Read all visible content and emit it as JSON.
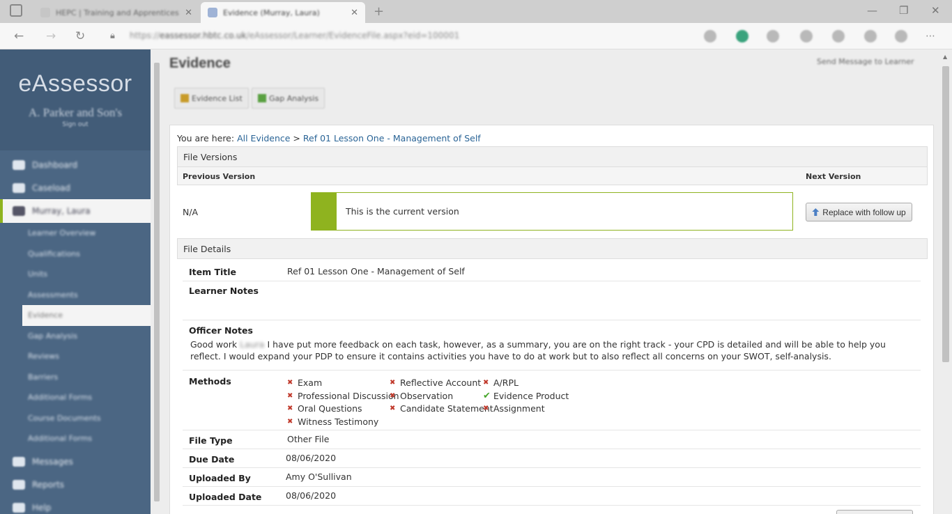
{
  "browser": {
    "tabs": [
      {
        "title": "HEPC | Training and Apprentices",
        "active": false
      },
      {
        "title": "Evidence (Murray, Laura)",
        "active": true
      }
    ],
    "url_prefix": "https://",
    "url_domain": "eassessor.hbtc.co.uk",
    "url_path": "/eAssessor/Learner/EvidenceFile.aspx?eid=100001"
  },
  "sidebar": {
    "brand": "eAssessor",
    "org": "A. Parker and Son's",
    "signout": "Sign out",
    "nav": [
      {
        "label": "Dashboard",
        "icon": "dashboard-icon"
      },
      {
        "label": "Caseload",
        "icon": "caseload-icon"
      },
      {
        "label": "Murray, Laura",
        "icon": "learner-icon"
      }
    ],
    "subnav": [
      "Learner Overview",
      "Qualifications",
      "Units",
      "Assessments",
      "Evidence",
      "Gap Analysis",
      "Reviews",
      "Barriers",
      "Additional Forms",
      "Course Documents",
      "Additional Forms"
    ],
    "nav_bottom": [
      {
        "label": "Messages",
        "icon": "messages-icon"
      },
      {
        "label": "Reports",
        "icon": "reports-icon"
      },
      {
        "label": "Help",
        "icon": "help-icon"
      }
    ]
  },
  "main": {
    "title": "Evidence",
    "send_message": "Send Message to Learner",
    "evidence_list_btn": "Evidence List",
    "gap_analysis_btn": "Gap Analysis",
    "breadcrumb": {
      "prefix": "You are here:",
      "root": "All Evidence",
      "sep": ">",
      "current": "Ref 01 Lesson One - Management of Self"
    },
    "file_versions": {
      "heading": "File Versions",
      "previous_label": "Previous Version",
      "next_label": "Next Version",
      "previous_value": "N/A",
      "current_text": "This is the current version",
      "replace_btn": "Replace with follow up"
    },
    "file_details": {
      "heading": "File Details",
      "item_title_label": "Item Title",
      "item_title": "Ref 01 Lesson One - Management of Self",
      "learner_notes_label": "Learner Notes",
      "officer_notes_label": "Officer Notes",
      "officer_notes_pre": "Good work",
      "officer_notes_name": "Laura",
      "officer_notes_post": "I have put more feedback on each task, however, as a summary, you are on the right track - your CPD is detailed and will be able to help you reflect. I would expand your PDP to ensure it contains activities you have to do at work but to also reflect all concerns on your SWOT, self-analysis.",
      "methods_label": "Methods",
      "methods": [
        [
          {
            "label": "Exam",
            "checked": false
          },
          {
            "label": "Professional Discussion",
            "checked": false
          },
          {
            "label": "Oral Questions",
            "checked": false
          },
          {
            "label": "Witness Testimony",
            "checked": false
          }
        ],
        [
          {
            "label": "Reflective Account",
            "checked": false
          },
          {
            "label": "Observation",
            "checked": false
          },
          {
            "label": "Candidate Statement",
            "checked": false
          }
        ],
        [
          {
            "label": "A/RPL",
            "checked": false
          },
          {
            "label": "Evidence Product",
            "checked": true
          },
          {
            "label": "Assignment",
            "checked": false
          }
        ]
      ],
      "file_type_label": "File Type",
      "file_type": "Other File",
      "due_date_label": "Due Date",
      "due_date": "08/06/2020",
      "uploaded_by_label": "Uploaded By",
      "uploaded_by": "Amy O'Sullivan",
      "uploaded_date_label": "Uploaded Date",
      "uploaded_date": "08/06/2020"
    }
  },
  "colors": {
    "sidebar": "#4b6683",
    "accent": "#8fb31f",
    "link": "#2a6496",
    "cross": "#c0392b",
    "check": "#46a62a"
  }
}
